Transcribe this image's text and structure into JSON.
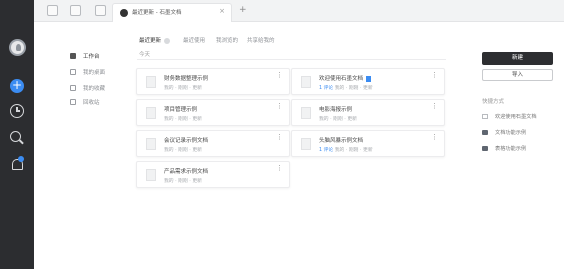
{
  "topbar": {
    "tab_title": "最近更新 - 石墨文档",
    "tab_close": "×",
    "add_tab": "+"
  },
  "rail": {
    "new_label": "+"
  },
  "nav": {
    "items": [
      {
        "label": "工作台",
        "active": true
      },
      {
        "label": "我的桌面",
        "active": false
      },
      {
        "label": "我的收藏",
        "active": false
      },
      {
        "label": "回收站",
        "active": false
      }
    ]
  },
  "filters": [
    {
      "label": "最近更新",
      "active": true
    },
    {
      "label": "最近使用",
      "active": false
    },
    {
      "label": "我浏览的",
      "active": false
    },
    {
      "label": "共享给我的",
      "active": false
    }
  ],
  "section": {
    "label": "今天"
  },
  "docs": [
    {
      "title": "财务数据整理示例",
      "meta": "我的 · 刚刚 · 更新",
      "comments": "",
      "tagged": false
    },
    {
      "title": "欢迎使用石墨文档",
      "meta": "我的 · 刚刚 · 更新",
      "comments": "1 评论",
      "tagged": true
    },
    {
      "title": "项目管理示例",
      "meta": "我的 · 刚刚 · 更新",
      "comments": "",
      "tagged": false
    },
    {
      "title": "电影海报示例",
      "meta": "我的 · 刚刚 · 更新",
      "comments": "",
      "tagged": false
    },
    {
      "title": "会议记录示例文档",
      "meta": "我的 · 刚刚 · 更新",
      "comments": "",
      "tagged": false
    },
    {
      "title": "头脑风暴示例文档",
      "meta": "我的 · 刚刚 · 更新",
      "comments": "1 评论",
      "tagged": false
    },
    {
      "title": "产品需求示例文档",
      "meta": "我的 · 刚刚 · 更新",
      "comments": "",
      "tagged": false
    }
  ],
  "more_icon": "⋮",
  "right_panel": {
    "new_button": "新建",
    "import_button": "导入",
    "shortcut_heading": "快捷方式",
    "shortcuts": [
      {
        "label": "欢迎使用石墨文档",
        "icon": "doc-icon"
      },
      {
        "label": "文档功能示例",
        "icon": "folder-icon"
      },
      {
        "label": "表格功能示例",
        "icon": "folder-icon"
      }
    ]
  },
  "colors": {
    "rail": "#2c2d30",
    "accent": "#3b8cf2",
    "primary_button": "#2d2e31"
  }
}
